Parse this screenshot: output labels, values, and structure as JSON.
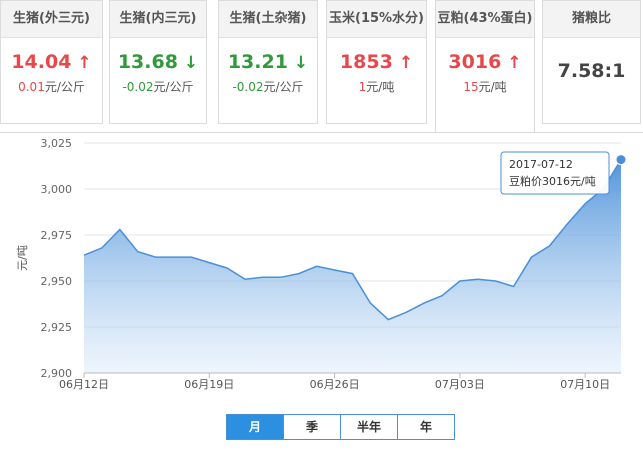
{
  "cards": [
    {
      "title": "生猪(外三元)",
      "value": "14.04",
      "dir": "up",
      "change": "0.01",
      "unit": "元/公斤"
    },
    {
      "title": "生猪(内三元)",
      "value": "13.68",
      "dir": "down",
      "change": "-0.02",
      "unit": "元/公斤"
    },
    {
      "title": "生猪(土杂猪)",
      "value": "13.21",
      "dir": "down",
      "change": "-0.02",
      "unit": "元/公斤"
    },
    {
      "title": "玉米(15%水分)",
      "value": "1853",
      "dir": "up",
      "change": "1",
      "unit": "元/吨"
    },
    {
      "title": "豆粕(43%蛋白)",
      "value": "3016",
      "dir": "up",
      "change": "15",
      "unit": "元/吨"
    },
    {
      "title": "猪粮比",
      "value": "7.58:1",
      "dir": "none",
      "change": "",
      "unit": ""
    }
  ],
  "colors": {
    "up": "#e9474a",
    "down": "#2f9a3a",
    "line": "#4a90d9",
    "tab_active": "#2d8fe0"
  },
  "icons": {
    "up": "arrow-up-icon",
    "down": "arrow-down-icon"
  },
  "tooltip": {
    "date": "2017-07-12",
    "text": "豆粕价3016元/吨"
  },
  "tabs": [
    {
      "label": "月",
      "selected": true
    },
    {
      "label": "季",
      "selected": false
    },
    {
      "label": "半年",
      "selected": false
    },
    {
      "label": "年",
      "selected": false
    }
  ],
  "chart_data": {
    "type": "area",
    "ylabel": "元/吨",
    "ylim": [
      2900,
      3025
    ],
    "yticks": [
      "3,025",
      "3,000",
      "2,975",
      "2,950",
      "2,925",
      "2,900"
    ],
    "ytick_values": [
      3025,
      3000,
      2975,
      2950,
      2925,
      2900
    ],
    "xticks": [
      "06月12日",
      "06月19日",
      "06月26日",
      "07月03日",
      "07月10日"
    ],
    "xtick_index": [
      0,
      7,
      14,
      21,
      28
    ],
    "grid": true,
    "series": [
      {
        "values": [
          2964,
          2968,
          2978,
          2966,
          2963,
          2963,
          2963,
          2960,
          2957,
          2951,
          2952,
          2952,
          2954,
          2958,
          2956,
          2954,
          2938,
          2929,
          2933,
          2938,
          2942,
          2950,
          2951,
          2950,
          2947,
          2963,
          2969,
          2981,
          2992,
          3000,
          3016
        ]
      }
    ]
  }
}
